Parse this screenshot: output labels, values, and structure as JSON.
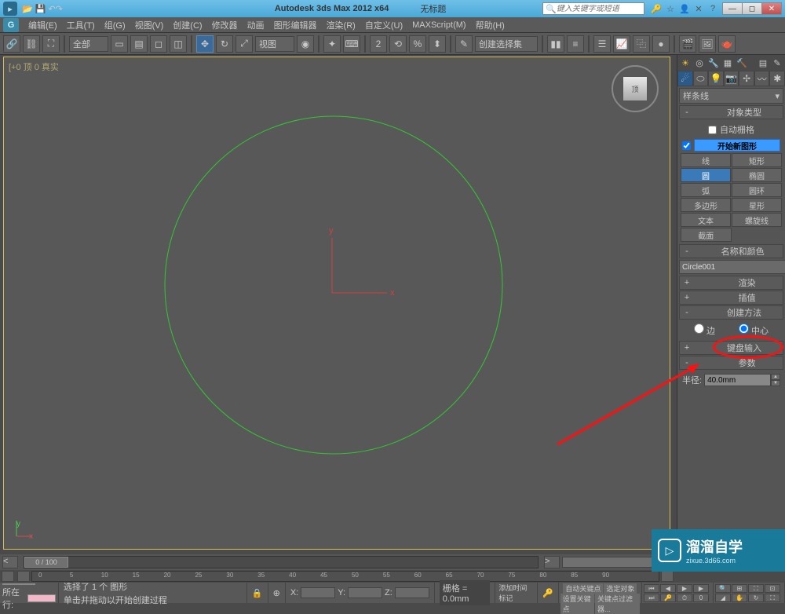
{
  "titlebar": {
    "title": "Autodesk 3ds Max 2012 x64",
    "untitled": "无标题",
    "search_placeholder": "键入关键字或短语"
  },
  "menu": {
    "edit": "编辑(E)",
    "tools": "工具(T)",
    "group": "组(G)",
    "views": "视图(V)",
    "create": "创建(C)",
    "modifiers": "修改器",
    "animation": "动画",
    "graph": "图形编辑器",
    "rendering": "渲染(R)",
    "customize": "自定义(U)",
    "maxscript": "MAXScript(M)",
    "help": "帮助(H)"
  },
  "toolbar": {
    "all": "全部",
    "view": "视图",
    "selection_set": "创建选择集"
  },
  "viewport": {
    "label": "[+0 顶 0 真实"
  },
  "panel": {
    "category": "样条线",
    "rollout_objtype": "对象类型",
    "auto_grid": "自动栅格",
    "start_new_shape": "开始新图形",
    "shapes": {
      "line": "线",
      "rectangle": "矩形",
      "circle": "圆",
      "ellipse": "椭圆",
      "arc": "弧",
      "donut": "圆环",
      "ngon": "多边形",
      "star": "星形",
      "text": "文本",
      "helix": "螺旋线",
      "section": "截面"
    },
    "rollout_name": "名称和颜色",
    "object_name": "Circle001",
    "rollout_render": "渲染",
    "rollout_interp": "插值",
    "rollout_method": "创建方法",
    "edge": "边",
    "center": "中心",
    "rollout_keyboard": "键盘输入",
    "rollout_params": "参数",
    "radius_label": "半径:",
    "radius_value": "40.0mm"
  },
  "timeline": {
    "slider": "0 / 100"
  },
  "status": {
    "selected": "选择了 1 个 图形",
    "prompt": "单击并拖动以开始创建过程",
    "row_label": "所在行:",
    "grid": "栅格 = 0.0mm",
    "autokey": "自动关键点",
    "setkey": "设置关键点",
    "selected_obj": "选定对象",
    "keyfilters": "关键点过滤器...",
    "add_time_tag": "添加时间标记",
    "x": "X:",
    "y": "Y:",
    "z": "Z:"
  },
  "watermark": {
    "name": "溜溜自学",
    "url": "zixue.3d66.com"
  }
}
